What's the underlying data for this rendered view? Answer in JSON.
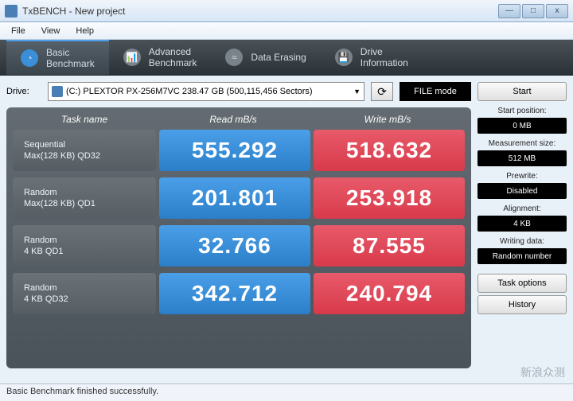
{
  "window": {
    "title": "TxBENCH - New project"
  },
  "menu": {
    "file": "File",
    "view": "View",
    "help": "Help"
  },
  "tabs": {
    "basic": {
      "line1": "Basic",
      "line2": "Benchmark"
    },
    "advanced": {
      "line1": "Advanced",
      "line2": "Benchmark"
    },
    "erasing": {
      "label": "Data Erasing"
    },
    "drive": {
      "line1": "Drive",
      "line2": "Information"
    }
  },
  "drive": {
    "label": "Drive:",
    "selected": "(C:) PLEXTOR PX-256M7VC  238.47 GB (500,115,456 Sectors)",
    "mode_btn": "FILE mode"
  },
  "headers": {
    "task": "Task name",
    "read": "Read mB/s",
    "write": "Write mB/s"
  },
  "rows": [
    {
      "name1": "Sequential",
      "name2": "Max(128 KB) QD32",
      "read": "555.292",
      "write": "518.632"
    },
    {
      "name1": "Random",
      "name2": "Max(128 KB) QD1",
      "read": "201.801",
      "write": "253.918"
    },
    {
      "name1": "Random",
      "name2": "4 KB QD1",
      "read": "32.766",
      "write": "87.555"
    },
    {
      "name1": "Random",
      "name2": "4 KB QD32",
      "read": "342.712",
      "write": "240.794"
    }
  ],
  "side": {
    "start_btn": "Start",
    "start_pos_label": "Start position:",
    "start_pos_value": "0 MB",
    "meas_size_label": "Measurement size:",
    "meas_size_value": "512 MB",
    "prewrite_label": "Prewrite:",
    "prewrite_value": "Disabled",
    "alignment_label": "Alignment:",
    "alignment_value": "4 KB",
    "writing_label": "Writing data:",
    "writing_value": "Random number",
    "task_options_btn": "Task options",
    "history_btn": "History"
  },
  "status": "Basic Benchmark finished successfully.",
  "watermark": "新浪众测"
}
